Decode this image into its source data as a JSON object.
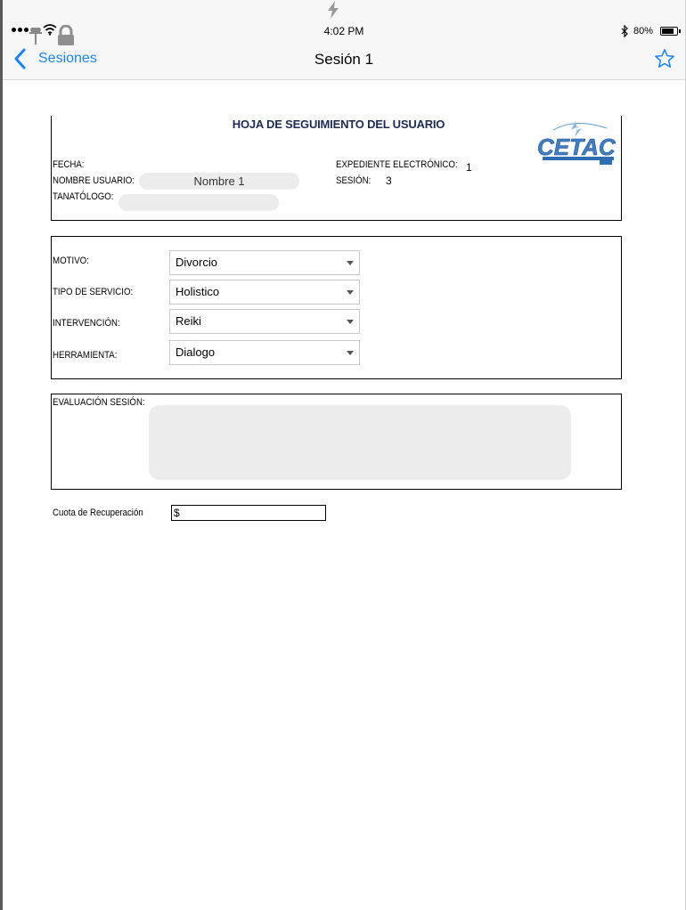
{
  "status_bar": {
    "time": "4:02 PM",
    "battery_percent": "80%",
    "battery_level": 0.8
  },
  "nav": {
    "back_label": "Sesiones",
    "title": "Sesión 1",
    "accent_color": "#1a82fb"
  },
  "form": {
    "title": "HOJA DE SEGUIMIENTO DEL USUARIO",
    "logo_text": "CETAC",
    "header": {
      "fecha_label": "FECHA:",
      "fecha_value": "",
      "nombre_label": "NOMBRE USUARIO:",
      "nombre_value": "Nombre 1",
      "tanatologo_label": "TANATÓLOGO:",
      "tanatologo_value": "",
      "expediente_label": "EXPEDIENTE ELECTRÓNICO:",
      "expediente_value": "1",
      "sesion_label": "SESIÓN:",
      "sesion_value": "3"
    },
    "selects": {
      "motivo_label": "MOTIVO:",
      "motivo_value": "Divorcio",
      "tipo_label": "TIPO DE SERVICIO:",
      "tipo_value": "Holistico",
      "intervencion_label": "INTERVENCIÓN:",
      "intervencion_value": "Reiki",
      "herramienta_label": "HERRAMIENTA:",
      "herramienta_value": "Dialogo"
    },
    "evaluacion_label": "EVALUACIÓN SESIÓN:",
    "evaluacion_value": "",
    "cuota_label": "Cuota de Recuperación",
    "cuota_value": "$"
  },
  "icons": [
    "charging-icon",
    "pin-icon",
    "wifi-icon",
    "lock-icon",
    "bluetooth-icon",
    "battery-icon",
    "back-chevron-icon",
    "star-icon"
  ]
}
